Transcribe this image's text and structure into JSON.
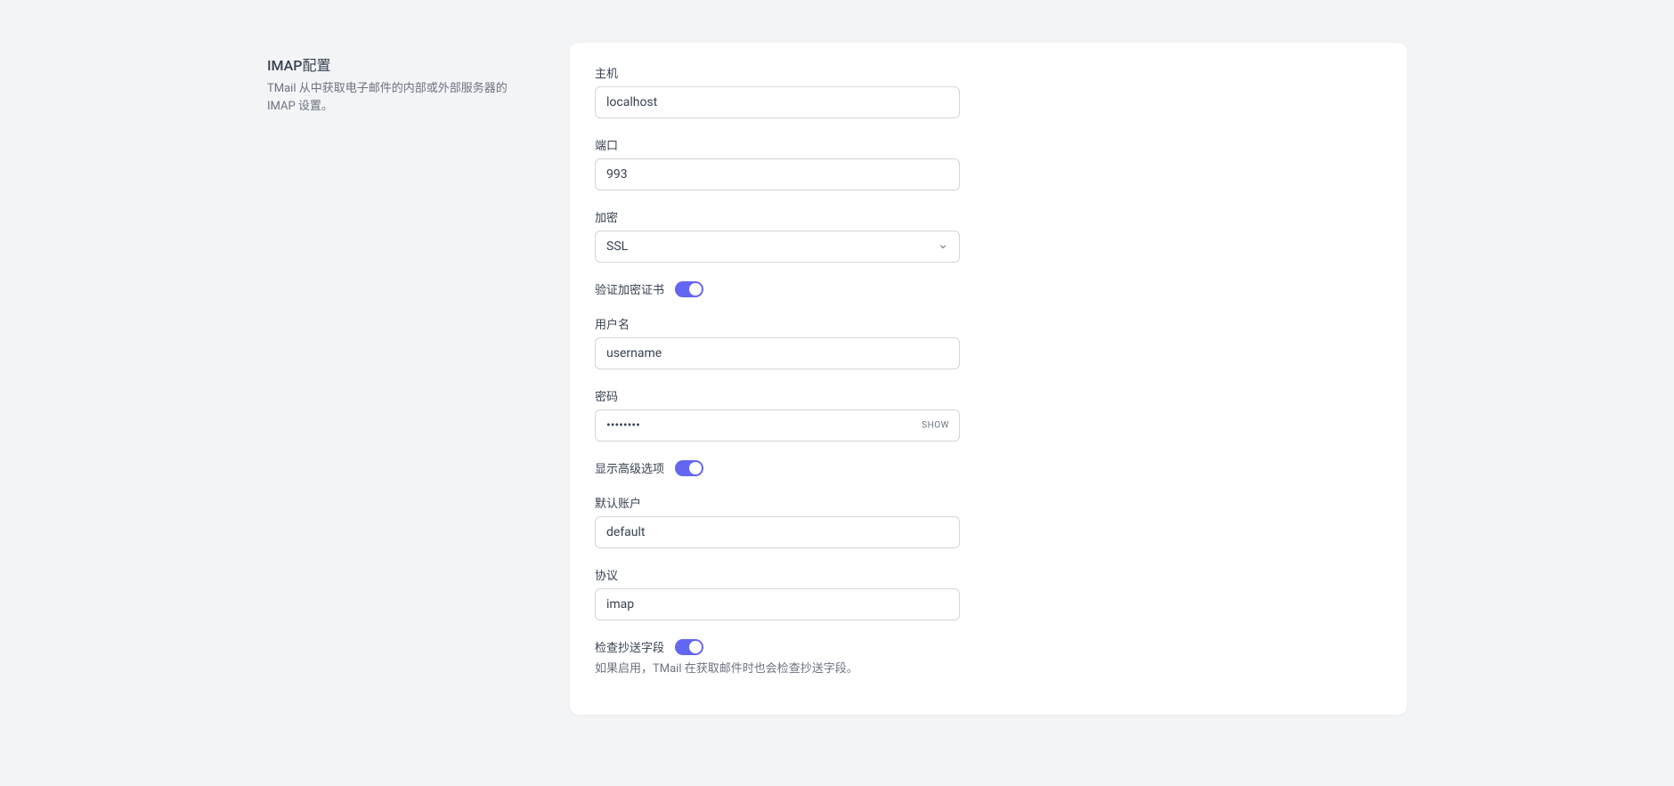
{
  "sidebar": {
    "title": "IMAP配置",
    "description": "TMail 从中获取电子邮件的内部或外部服务器的 IMAP 设置。"
  },
  "form": {
    "host": {
      "label": "主机",
      "value": "localhost"
    },
    "port": {
      "label": "端口",
      "value": "993"
    },
    "encryption": {
      "label": "加密",
      "value": "SSL"
    },
    "validateCert": {
      "label": "验证加密证书"
    },
    "username": {
      "label": "用户名",
      "value": "username"
    },
    "password": {
      "label": "密码",
      "value": "••••••••",
      "showBtn": "SHOW"
    },
    "advanced": {
      "label": "显示高级选项"
    },
    "defaultAccount": {
      "label": "默认账户",
      "value": "default"
    },
    "protocol": {
      "label": "协议",
      "value": "imap"
    },
    "checkCc": {
      "label": "检查抄送字段",
      "help": "如果启用，TMail 在获取邮件时也会检查抄送字段。"
    }
  }
}
